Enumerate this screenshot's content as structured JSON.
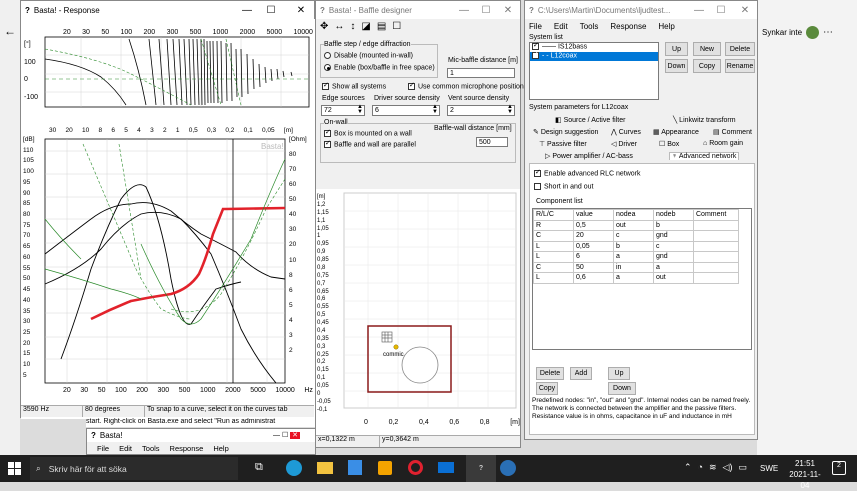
{
  "desktop": {
    "right_icon_text": "Synkar inte"
  },
  "response": {
    "title": "Basta! - Response",
    "phase_ticks": [
      "20",
      "30",
      "50",
      "100",
      "200",
      "300",
      "500",
      "1000",
      "2000",
      "5000",
      "10000"
    ],
    "phase_y": [
      "[°]",
      "100",
      "0",
      "-100"
    ],
    "mid_ticks": [
      "30",
      "20",
      "10",
      "8",
      "6",
      "5",
      "4",
      "3",
      "2",
      "1",
      "0,5",
      "0,3",
      "0,2",
      "0,1",
      "0,05",
      "[m]"
    ],
    "db_labels": [
      "[dB]",
      "110",
      "105",
      "100",
      "95",
      "90",
      "85",
      "80",
      "75",
      "70",
      "65",
      "60",
      "55",
      "50",
      "45",
      "40",
      "35",
      "30",
      "25",
      "20",
      "15",
      "10",
      "5"
    ],
    "ohm_labels": [
      "[Ohm]",
      "80",
      "70",
      "60",
      "50",
      "40",
      "30",
      "20",
      "10",
      "8",
      "6",
      "5",
      "4",
      "3",
      "2"
    ],
    "watermark": "Basta!",
    "freq_ticks": [
      "20",
      "30",
      "50",
      "100",
      "200",
      "300",
      "500",
      "1000",
      "2000",
      "5000",
      "10000",
      "Hz"
    ],
    "status": [
      "3590 Hz",
      "80 degrees",
      "To snap to a curve, select it on the curves tab"
    ],
    "behind_text": "start. Right-click on Basta.exe and select \"Run as administrat"
  },
  "baffle": {
    "title": "Basta! - Baffle designer",
    "toolbar": [
      "✥",
      "↔",
      "↕",
      "◪",
      "▤",
      "☐"
    ],
    "step_group": "Baffle step / edge diffraction",
    "opt_disable": "Disable (mounted in-wall)",
    "opt_enable": "Enable (box/baffle in free space)",
    "midbaffle_label": "Mic-baffle distance [m]",
    "midbaffle_value": "1",
    "show_all": "Show all systems",
    "common_mic": "Use common microphone position",
    "edge_label": "Edge sources",
    "edge_value": "72",
    "driver_density_label": "Driver source density",
    "driver_density_value": "6",
    "vent_density_label": "Vent source density",
    "vent_density_value": "2",
    "onwall_group": "On-wall",
    "mounted_on_wall": "Box is mounted on a wall",
    "parallel": "Baffle and wall are parallel",
    "wall_dist_label": "Baffle-wall distance [mm]",
    "wall_dist_value": "500",
    "y_labels": [
      "[m]",
      "1,2",
      "1,15",
      "1,1",
      "1,05",
      "1",
      "0,95",
      "0,9",
      "0,85",
      "0,8",
      "0,75",
      "0,7",
      "0,65",
      "0,6",
      "0,55",
      "0,5",
      "0,45",
      "0,4",
      "0,35",
      "0,3",
      "0,25",
      "0,2",
      "0,15",
      "0,1",
      "0,05",
      "0",
      "-0,05",
      "-0,1"
    ],
    "x_labels": [
      "0",
      "0,2",
      "0,4",
      "0,6",
      "0,8",
      "[m]"
    ],
    "mic_label": "commic",
    "status_x": "x=0,1322 m",
    "status_y": "y=0,3642 m"
  },
  "network": {
    "title": "C:\\Users\\Martin\\Documents\\ljudtest...",
    "menu": [
      "File",
      "Edit",
      "Tools",
      "Response",
      "Help"
    ],
    "system_list_label": "System list",
    "systems": [
      {
        "name": "IS12bass",
        "selected": false
      },
      {
        "name": "L12coax",
        "selected": true
      }
    ],
    "btn_up": "Up",
    "btn_new": "New",
    "btn_delete": "Delete",
    "btn_down": "Down",
    "btn_copy": "Copy",
    "btn_rename": "Rename",
    "params_label": "System parameters for L12coax",
    "tabs_row1": [
      "Source / Active filter",
      "Linkwitz transform"
    ],
    "tabs_row2": [
      "Design suggestion",
      "Curves",
      "Appearance",
      "Comment"
    ],
    "tabs_row3": [
      "Passive filter",
      "Driver",
      "Box",
      "Room gain"
    ],
    "tabs_row4": [
      "Power amplifier / AC-bass",
      "Advanced network"
    ],
    "enable_rlc": "Enable advanced RLC network",
    "short_io": "Short in and out",
    "component_list_label": "Component list",
    "columns": [
      "R/L/C",
      "value",
      "nodea",
      "nodeb",
      "Comment"
    ],
    "rows": [
      [
        "R",
        "0,5",
        "out",
        "b",
        ""
      ],
      [
        "C",
        "20",
        "c",
        "gnd",
        ""
      ],
      [
        "L",
        "0,05",
        "b",
        "c",
        ""
      ],
      [
        "L",
        "6",
        "a",
        "gnd",
        ""
      ],
      [
        "C",
        "50",
        "in",
        "a",
        ""
      ],
      [
        "L",
        "0,6",
        "a",
        "out",
        ""
      ]
    ],
    "btn_cdelete": "Delete",
    "btn_add": "Add",
    "btn_cup": "Up",
    "btn_ccopy": "Copy",
    "btn_cdown": "Down",
    "help_text": "Predefined nodes: \"in\", \"out\" and \"gnd\". Internal nodes can be named freely. The network is connected between the amplifier and the passive filters. Resistance value is in ohms, capacitance in uF and inductance in mH"
  },
  "small_basta": {
    "title": "Basta!",
    "menu": [
      "File",
      "Edit",
      "Tools",
      "Response",
      "Help"
    ]
  },
  "taskbar": {
    "search": "Skriv här för att söka",
    "lang": "SWE",
    "time": "21:51",
    "date": "2021-11-04",
    "notif": "2"
  },
  "colors": {
    "accent": "#0078d7",
    "red_curve": "#e2222b",
    "green_curve": "#2a8a2a",
    "taskbar": "#1f1f1f"
  }
}
